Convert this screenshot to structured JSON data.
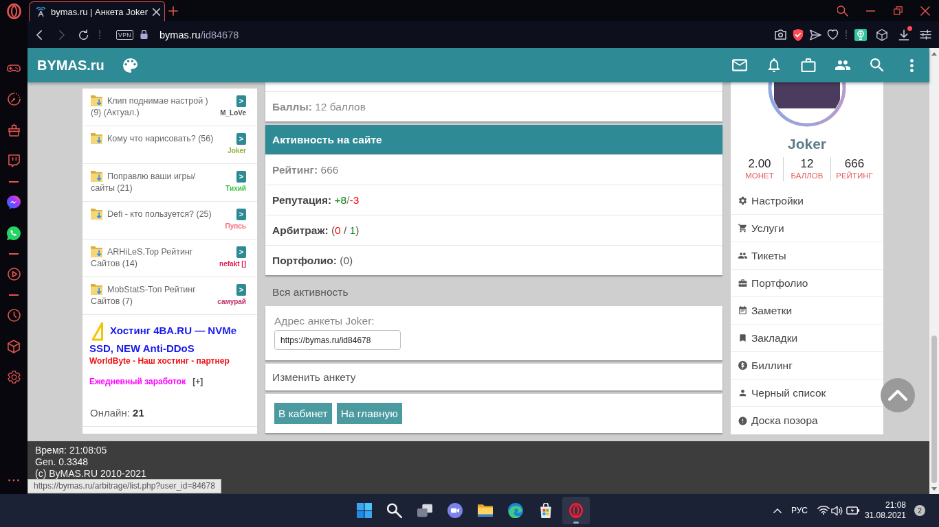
{
  "browser": {
    "tabs": [
      {
        "title": "bymas.ru | Анкета Joker",
        "selected": true
      }
    ],
    "vpn": "VPN",
    "url_host": "bymas.ru",
    "url_path": "/id84678",
    "download_alert": true,
    "status_link": "https://bymas.ru/arbitrage/list.php?user_id=84678"
  },
  "site_header": {
    "logo": "BYMAS.ru"
  },
  "topics": [
    {
      "title": "Клип поднимае настрой ) (9) (Актуал.)",
      "author": "M_LoVe",
      "color": "#555555",
      "button": ">"
    },
    {
      "title": "Кому что нарисовать? (56)",
      "author": "Joker",
      "color": "#8db33a",
      "button": ">"
    },
    {
      "title": "Поправлю ваши игры/ сайты (21)",
      "author": "Тихий",
      "color": "#3cc13c",
      "button": ">"
    },
    {
      "title": "Defi - кто пользуется? (25)",
      "author": "Пупсь",
      "color": "#f06e7e",
      "button": ">"
    },
    {
      "title": "ARHiLeS.Top Рейтинг Сайтов (14)",
      "author": "nefakt []",
      "color": "#dc1e50",
      "button": ">"
    },
    {
      "title": "MobStatS-Топ Рейтинг Сайтов (7)",
      "author": "самурай",
      "color": "#c0306a",
      "button": ">"
    }
  ],
  "ad": {
    "hosting": "Хостинг 4BA.RU — NVMe SSD, NEW Anti-DDoS",
    "partner": "WorldByte - Наш хостинг - партнер",
    "earnings": "Ежедневный заработок",
    "expand": "[+]"
  },
  "online": "Онлайн: **21**",
  "points": {
    "label": "Баллы:",
    "value": "12 баллов",
    "muted": true
  },
  "activity": {
    "title": "Активность на сайте",
    "rows": [
      {
        "label": "Рейтинг:",
        "muted": true,
        "parts": [
          {
            "text": "666",
            "color": "#808080"
          }
        ]
      },
      {
        "label": "Репутация:",
        "muted": false,
        "parts": [
          {
            "text": "+8",
            "color": "#008000"
          },
          {
            "text": "/",
            "color": "#808080"
          },
          {
            "text": "-3",
            "color": "#ff0000"
          }
        ]
      },
      {
        "label": "Арбитраж:",
        "muted": false,
        "parts": [
          {
            "text": "(",
            "color": "#555555"
          },
          {
            "text": "0",
            "color": "#ff0000"
          },
          {
            "text": " / ",
            "color": "#555555"
          },
          {
            "text": "1",
            "color": "#008000"
          },
          {
            "text": ")",
            "color": "#555555"
          }
        ]
      },
      {
        "label": "Портфолио:",
        "muted": false,
        "parts": [
          {
            "text": "(0)",
            "color": "#555555"
          }
        ]
      }
    ]
  },
  "all_activity": "Вся активность",
  "profile_link": {
    "label": "Адрес анкеты Joker:",
    "value": "https://bymas.ru/id84678"
  },
  "edit_profile": "Изменить анкету",
  "buttons": [
    "В кабинет",
    "На главную"
  ],
  "profile": {
    "name": "Joker",
    "stats": [
      {
        "value": "2.00",
        "label": "МОНЕТ"
      },
      {
        "value": "12",
        "label": "БАЛЛОВ"
      },
      {
        "value": "666",
        "label": "РЕЙТИНГ"
      }
    ],
    "menu": [
      "Настройки",
      "Услуги",
      "Тикеты",
      "Портфолио",
      "Заметки",
      "Закладки",
      "Биллинг",
      "Черный список",
      "Доска позора"
    ]
  },
  "footer": [
    "Время: 21:08:05",
    "Gen. 0.3348",
    "(c) ByMAS.RU 2010-2021"
  ],
  "taskbar": {
    "apps": [
      {
        "selected": false
      },
      {
        "selected": false
      },
      {
        "selected": false
      },
      {
        "selected": false
      },
      {
        "selected": false
      },
      {
        "selected": false
      },
      {
        "selected": false
      },
      {
        "selected": true
      }
    ],
    "language": "РУС",
    "time": "21:08",
    "date": "31.08.2021",
    "notifications": "2"
  }
}
